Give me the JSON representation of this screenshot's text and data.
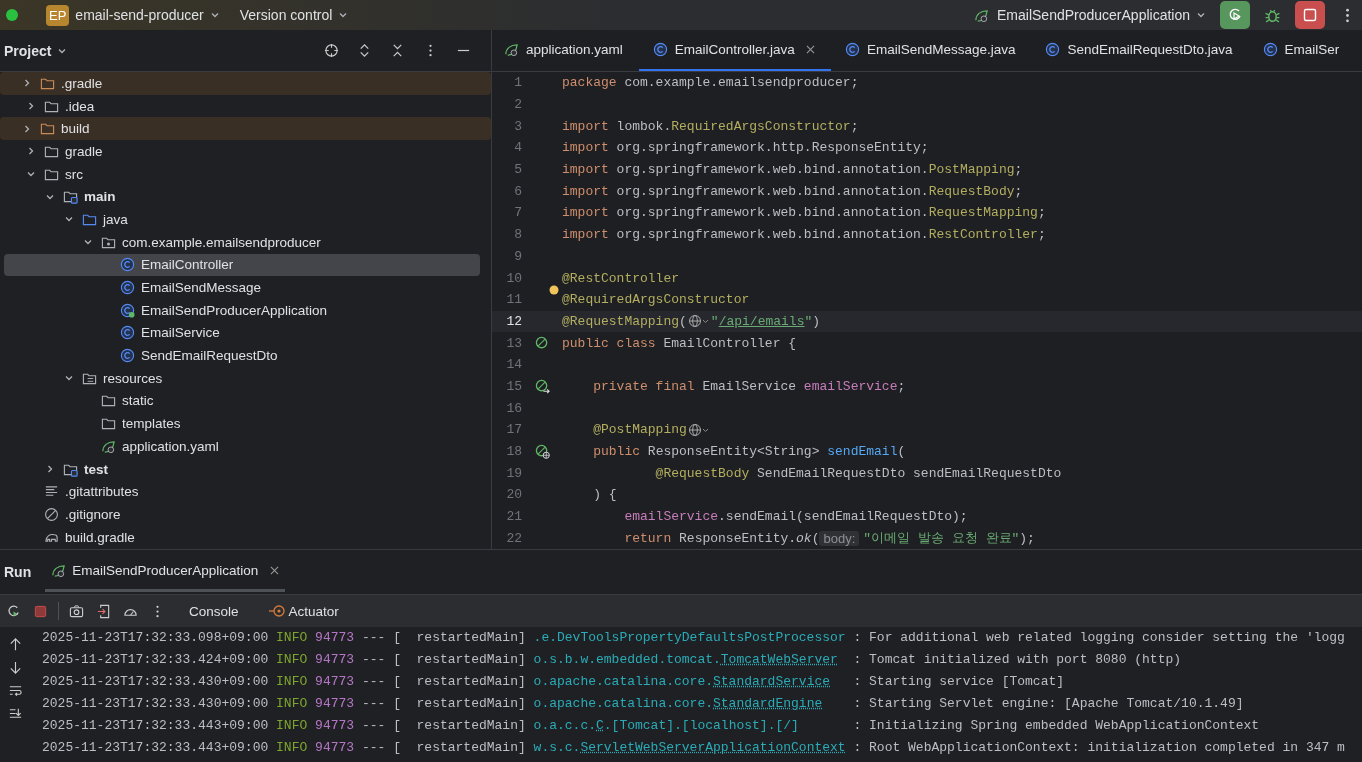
{
  "title_bar": {
    "badge": "EP",
    "project": "email-send-producer",
    "vcs": "Version control",
    "run_config": "EmailSendProducerApplication"
  },
  "project_panel": {
    "title": "Project",
    "tree": [
      {
        "label": ".gradle",
        "kind": "folder",
        "excluded": true,
        "expanded": false,
        "selected": false
      },
      {
        "label": ".idea",
        "kind": "folder",
        "excluded": false,
        "expanded": false,
        "selected": false
      },
      {
        "label": "build",
        "kind": "folder",
        "excluded": true,
        "expanded": false,
        "selected": false
      },
      {
        "label": "gradle",
        "kind": "folder",
        "excluded": false,
        "expanded": false,
        "selected": false
      },
      {
        "label": "src",
        "kind": "folder",
        "excluded": false,
        "expanded": true,
        "selected": false,
        "children": [
          {
            "label": "main",
            "kind": "source-set",
            "excluded": false,
            "expanded": true,
            "selected": false,
            "children": [
              {
                "label": "java",
                "kind": "source-root",
                "excluded": false,
                "expanded": true,
                "selected": false,
                "children": [
                  {
                    "label": "com.example.emailsendproducer",
                    "kind": "package",
                    "excluded": false,
                    "expanded": true,
                    "selected": false,
                    "children": [
                      {
                        "label": "EmailController",
                        "kind": "class",
                        "excluded": false,
                        "selected": true
                      },
                      {
                        "label": "EmailSendMessage",
                        "kind": "class",
                        "excluded": false,
                        "selected": false
                      },
                      {
                        "label": "EmailSendProducerApplication",
                        "kind": "app-class",
                        "excluded": false,
                        "selected": false
                      },
                      {
                        "label": "EmailService",
                        "kind": "class",
                        "excluded": false,
                        "selected": false
                      },
                      {
                        "label": "SendEmailRequestDto",
                        "kind": "class",
                        "excluded": false,
                        "selected": false
                      }
                    ]
                  }
                ]
              },
              {
                "label": "resources",
                "kind": "resources",
                "excluded": false,
                "expanded": true,
                "selected": false,
                "children": [
                  {
                    "label": "static",
                    "kind": "folder",
                    "excluded": false,
                    "selected": false
                  },
                  {
                    "label": "templates",
                    "kind": "folder",
                    "excluded": false,
                    "selected": false
                  },
                  {
                    "label": "application.yaml",
                    "kind": "yaml",
                    "excluded": false,
                    "selected": false
                  }
                ]
              }
            ]
          },
          {
            "label": "test",
            "kind": "source-set",
            "excluded": false,
            "expanded": false,
            "selected": false
          }
        ]
      },
      {
        "label": ".gitattributes",
        "kind": "text",
        "excluded": false,
        "selected": false
      },
      {
        "label": ".gitignore",
        "kind": "ignore",
        "excluded": false,
        "selected": false
      },
      {
        "label": "build.gradle",
        "kind": "gradle",
        "excluded": false,
        "selected": false
      }
    ]
  },
  "editor": {
    "tabs": [
      {
        "label": "application.yaml",
        "kind": "yaml",
        "selected": false
      },
      {
        "label": "EmailController.java",
        "kind": "class",
        "selected": true
      },
      {
        "label": "EmailSendMessage.java",
        "kind": "class",
        "selected": false
      },
      {
        "label": "SendEmailRequestDto.java",
        "kind": "class",
        "selected": false
      },
      {
        "label": "EmailSer",
        "kind": "class",
        "selected": false
      }
    ],
    "lines": [
      {
        "num": "1",
        "segs": [
          {
            "kind": "kw",
            "t": "package"
          },
          {
            "kind": "plain",
            "t": " com.example.emailsendproducer;"
          }
        ]
      },
      {
        "num": "2"
      },
      {
        "num": "3",
        "segs": [
          {
            "kind": "kw",
            "t": "import"
          },
          {
            "kind": "plain",
            "t": " lombok."
          },
          {
            "kind": "ann",
            "t": "RequiredArgsConstructor"
          },
          {
            "kind": "plain",
            "t": ";"
          }
        ]
      },
      {
        "num": "4",
        "segs": [
          {
            "kind": "kw",
            "t": "import"
          },
          {
            "kind": "plain",
            "t": " org.springframework.http.ResponseEntity;"
          }
        ]
      },
      {
        "num": "5",
        "segs": [
          {
            "kind": "kw",
            "t": "import"
          },
          {
            "kind": "plain",
            "t": " org.springframework.web.bind.annotation."
          },
          {
            "kind": "ann",
            "t": "PostMapping"
          },
          {
            "kind": "plain",
            "t": ";"
          }
        ]
      },
      {
        "num": "6",
        "segs": [
          {
            "kind": "kw",
            "t": "import"
          },
          {
            "kind": "plain",
            "t": " org.springframework.web.bind.annotation."
          },
          {
            "kind": "ann",
            "t": "RequestBody"
          },
          {
            "kind": "plain",
            "t": ";"
          }
        ]
      },
      {
        "num": "7",
        "segs": [
          {
            "kind": "kw",
            "t": "import"
          },
          {
            "kind": "plain",
            "t": " org.springframework.web.bind.annotation."
          },
          {
            "kind": "ann",
            "t": "RequestMapping"
          },
          {
            "kind": "plain",
            "t": ";"
          }
        ]
      },
      {
        "num": "8",
        "segs": [
          {
            "kind": "kw",
            "t": "import"
          },
          {
            "kind": "plain",
            "t": " org.springframework.web.bind.annotation."
          },
          {
            "kind": "ann",
            "t": "RestController"
          },
          {
            "kind": "plain",
            "t": ";"
          }
        ]
      },
      {
        "num": "9"
      },
      {
        "num": "10",
        "segs": [
          {
            "kind": "ann",
            "t": "@RestController"
          }
        ]
      },
      {
        "num": "11",
        "bulb": true,
        "segs": [
          {
            "kind": "ann",
            "t": "@RequiredArgsConstructor"
          }
        ]
      },
      {
        "num": "12",
        "current": true,
        "segs": [
          {
            "kind": "ann",
            "t": "@RequestMapping"
          },
          {
            "kind": "plain",
            "t": "("
          },
          {
            "kind": "globe"
          },
          {
            "kind": "str",
            "t": "\""
          },
          {
            "kind": "link",
            "t": "/api/emails"
          },
          {
            "kind": "str",
            "t": "\""
          },
          {
            "kind": "plain",
            "t": ")"
          }
        ]
      },
      {
        "num": "13",
        "gutter": {
          "kind": "bean"
        },
        "segs": [
          {
            "kind": "kw",
            "t": "public class "
          },
          {
            "kind": "plain",
            "t": "EmailController {"
          }
        ]
      },
      {
        "num": "14"
      },
      {
        "num": "15",
        "gutter": {
          "kind": "bean-arrow"
        },
        "segs": [
          {
            "kind": "kw",
            "t": "    private final "
          },
          {
            "kind": "plain",
            "t": "EmailService "
          },
          {
            "kind": "field",
            "t": "emailService"
          },
          {
            "kind": "plain",
            "t": ";"
          }
        ]
      },
      {
        "num": "16"
      },
      {
        "num": "17",
        "segs": [
          {
            "kind": "ann",
            "t": "    @PostMapping"
          },
          {
            "kind": "globe"
          }
        ]
      },
      {
        "num": "18",
        "gutter": {
          "kind": "bean-web"
        },
        "segs": [
          {
            "kind": "kw",
            "t": "    public "
          },
          {
            "kind": "plain",
            "t": "ResponseEntity<String> "
          },
          {
            "kind": "method",
            "t": "sendEmail"
          },
          {
            "kind": "plain",
            "t": "("
          }
        ]
      },
      {
        "num": "19",
        "segs": [
          {
            "kind": "ann",
            "t": "            @RequestBody "
          },
          {
            "kind": "plain",
            "t": "SendEmailRequestDto sendEmailRequestDto"
          }
        ]
      },
      {
        "num": "20",
        "segs": [
          {
            "kind": "plain",
            "t": "    ) {"
          }
        ]
      },
      {
        "num": "21",
        "segs": [
          {
            "kind": "field",
            "t": "        emailService"
          },
          {
            "kind": "plain",
            "t": ".sendEmail(sendEmailRequestDto);"
          }
        ]
      },
      {
        "num": "22",
        "segs": [
          {
            "kind": "kw",
            "t": "        return "
          },
          {
            "kind": "plain",
            "t": "ResponseEntity."
          },
          {
            "kind": "static",
            "t": "ok"
          },
          {
            "kind": "plain",
            "t": "("
          },
          {
            "kind": "hint",
            "t": "body:"
          },
          {
            "kind": "str",
            "t": "\"이메일 발송 요청 완료\""
          },
          {
            "kind": "plain",
            "t": ");"
          }
        ]
      }
    ]
  },
  "run_panel": {
    "title": "Run",
    "tab": "EmailSendProducerApplication",
    "tool_tabs": [
      {
        "label": "Console",
        "kind": "console"
      },
      {
        "label": "Actuator",
        "kind": "actuator"
      }
    ],
    "log": [
      {
        "time": "2025-11-23T17:32:33.098+09:00",
        "level": "INFO",
        "pid": "94773",
        "sep": "---",
        "thread": "[  restartedMain]",
        "logger": {
          "pkg": ".e.DevToolsPropertyDefaultsPostProcessor"
        },
        "message": ": For additional web related logging consider setting the 'logg"
      },
      {
        "time": "2025-11-23T17:32:33.424+09:00",
        "level": "INFO",
        "pid": "94773",
        "sep": "---",
        "thread": "[  restartedMain]",
        "logger": {
          "pkg": "o.s.b.w.embedded.tomcat.",
          "cls": "TomcatWebServer"
        },
        "message": ": Tomcat initialized with port 8080 (http)"
      },
      {
        "time": "2025-11-23T17:32:33.430+09:00",
        "level": "INFO",
        "pid": "94773",
        "sep": "---",
        "thread": "[  restartedMain]",
        "logger": {
          "pkg": "o.apache.catalina.core.",
          "cls": "StandardService"
        },
        "message": ": Starting service [Tomcat]"
      },
      {
        "time": "2025-11-23T17:32:33.430+09:00",
        "level": "INFO",
        "pid": "94773",
        "sep": "---",
        "thread": "[  restartedMain]",
        "logger": {
          "pkg": "o.apache.catalina.core.",
          "cls": "StandardEngine"
        },
        "message": ": Starting Servlet engine: [Apache Tomcat/10.1.49]"
      },
      {
        "time": "2025-11-23T17:32:33.443+09:00",
        "level": "INFO",
        "pid": "94773",
        "sep": "---",
        "thread": "[  restartedMain]",
        "logger": {
          "pkg": "o.a.c.c.",
          "cls": "C",
          "suffix": ".[Tomcat].[localhost].[/]"
        },
        "message": ": Initializing Spring embedded WebApplicationContext"
      },
      {
        "time": "2025-11-23T17:32:33.443+09:00",
        "level": "INFO",
        "pid": "94773",
        "sep": "---",
        "thread": "[  restartedMain]",
        "logger": {
          "pkg": "w.s.c.",
          "cls": "ServletWebServerApplicationContext"
        },
        "message": ": Root WebApplicationContext: initialization completed in 347 m"
      }
    ]
  }
}
